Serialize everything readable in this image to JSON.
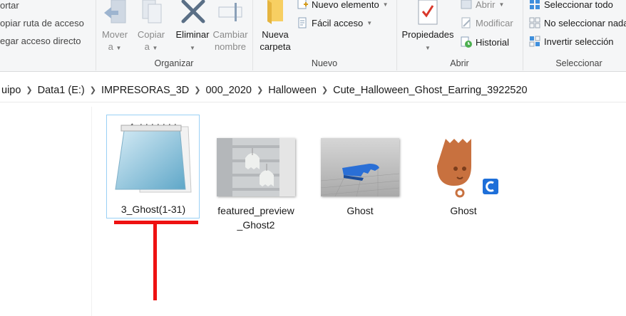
{
  "ribbon": {
    "clipboard": {
      "cut": "ortar",
      "copy_path": "opiar ruta de acceso",
      "paste_shortcut": "egar acceso directo"
    },
    "organize": {
      "label": "Organizar",
      "move_to": [
        "Mover",
        "a"
      ],
      "copy_to": [
        "Copiar",
        "a"
      ],
      "delete": "Eliminar",
      "rename": [
        "Cambiar",
        "nombre"
      ]
    },
    "new": {
      "label": "Nuevo",
      "new_folder": [
        "Nueva",
        "carpeta"
      ],
      "new_item": "Nuevo elemento",
      "easy_access": "Fácil acceso"
    },
    "open": {
      "label": "Abrir",
      "properties": "Propiedades",
      "open": "Abrir",
      "edit": "Modificar",
      "history": "Historial"
    },
    "select": {
      "label": "Seleccionar",
      "select_all": "Seleccionar todo",
      "select_none": "No seleccionar nada",
      "invert": "Invertir selección"
    }
  },
  "address": {
    "crumbs": [
      "uipo",
      "Data1 (E:)",
      "IMPRESORAS_3D",
      "000_2020",
      "Halloween",
      "Cute_Halloween_Ghost_Earring_3922520"
    ]
  },
  "files": [
    {
      "name": "3_Ghost(1-31)",
      "type": "text-file",
      "selected": true
    },
    {
      "name": "featured_preview_Ghost2",
      "name_lines": [
        "featured_preview",
        "_Ghost2"
      ],
      "type": "photo"
    },
    {
      "name": "Ghost",
      "type": "3d-render-blue"
    },
    {
      "name": "Ghost",
      "type": "ghost-model-orange"
    }
  ],
  "colors": {
    "accent_selection": "#9ad0f5",
    "annotation": "#ee1111",
    "ghost_orange": "#c8713f",
    "model_blue": "#2a6fd6"
  }
}
